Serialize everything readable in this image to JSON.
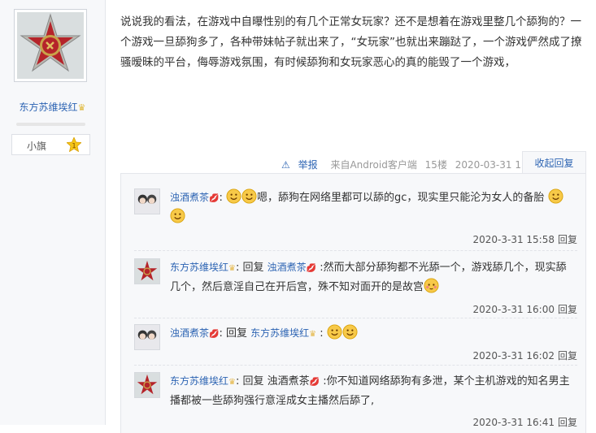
{
  "author": {
    "name": "东方苏维埃红",
    "vip_icon": "crown-icon",
    "badge": {
      "name": "小旗",
      "level": "1"
    }
  },
  "post": {
    "text": "说说我的看法，在游戏中自曝性别的有几个正常女玩家？还不是想着在游戏里整几个舔狗的？一个游戏一旦舔狗多了，各种带妹帖子就出来了，“女玩家”也就出来蹦跶了，一个游戏俨然成了撩骚暧昧的平台，侮辱游戏氛围，有时候舔狗和女玩家恶心的真的能毁了一个游戏，",
    "meta": {
      "report": "举报",
      "client": "来自Android客户端",
      "floor": "15楼",
      "datetime": "2020-03-31 15:41"
    },
    "collapse_label": "收起回复"
  },
  "replies": [
    {
      "user": "浊酒煮茶",
      "separator": ":",
      "reply_word": "",
      "target": "",
      "text": "嗯，舔狗在网络里都可以舔的gc，现实里只能沦为女人的备胎",
      "time": "2020-3-31 15:58",
      "reply_label": "回复"
    },
    {
      "user": "东方苏维埃红",
      "separator": ":",
      "reply_word": "回复",
      "target": "浊酒煮茶",
      "text": ":然而大部分舔狗都不光舔一个，游戏舔几个，现实舔几个，然后意淫自己在开后宫，殊不知对面开的是故宫",
      "time": "2020-3-31 16:00",
      "reply_label": "回复"
    },
    {
      "user": "浊酒煮茶",
      "separator": ":",
      "reply_word": "回复",
      "target": "东方苏维埃红",
      "text": ":",
      "time": "2020-3-31 16:02",
      "reply_label": "回复"
    },
    {
      "user": "东方苏维埃红",
      "separator": ":",
      "reply_word": "回复",
      "target": "浊酒煮茶",
      "text": ":你不知道网络舔狗有多泄，某个主机游戏的知名男主播都被一些舔狗强行意淫成女主播然后舔了,",
      "time": "2020-3-31 16:41",
      "reply_label": "回复"
    }
  ],
  "colors": {
    "link": "#2d64b3",
    "sidebar_bg": "#f7f8fa",
    "reply_bg": "#f7f8fa"
  }
}
